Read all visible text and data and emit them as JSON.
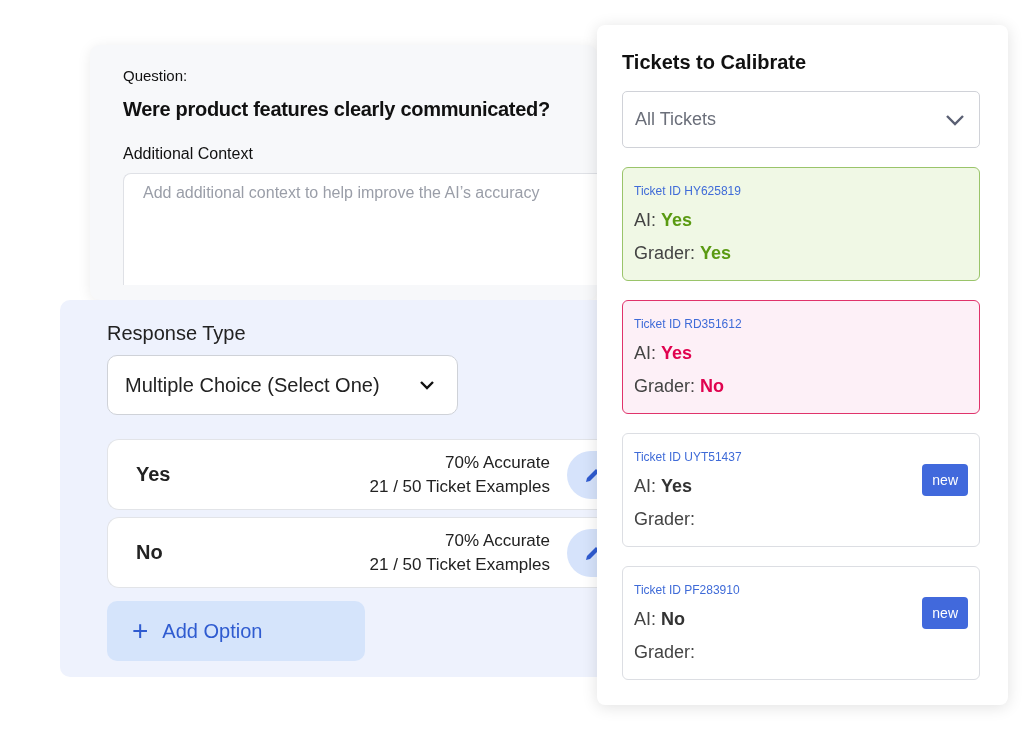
{
  "question_card": {
    "label": "Question:",
    "question": "Were product features clearly communicated?",
    "context_label": "Additional Context",
    "context_field": {
      "placeholder": "Add additional context to help improve the AI’s accuracy"
    }
  },
  "response_panel": {
    "label": "Response Type",
    "dropdown": "Multiple Choice (Select One)",
    "options": [
      {
        "name": "Yes",
        "accuracy": "70% Accurate",
        "examples": "21 / 50 Ticket Examples"
      },
      {
        "name": "No",
        "accuracy": "70% Accurate",
        "examples": "21 / 50 Ticket Examples"
      }
    ],
    "add_button": {
      "icon": "+",
      "label": "Add Option"
    }
  },
  "tickets_panel": {
    "title": "Tickets to Calibrate",
    "filter": "All Tickets",
    "tickets": [
      {
        "kind": "match",
        "id": "Ticket ID HY625819",
        "ai_label": "AI:",
        "ai_value": "Yes",
        "grader_label": "Grader:",
        "grader_value": "Yes"
      },
      {
        "kind": "mismatch",
        "id": "Ticket ID RD351612",
        "ai_label": "AI:",
        "ai_value": "Yes",
        "grader_label": "Grader:",
        "grader_value": "No"
      },
      {
        "kind": "new",
        "id": "Ticket ID UYT51437",
        "ai_label": "AI:",
        "ai_value": "Yes",
        "grader_label": "Grader:",
        "badge": "new"
      },
      {
        "kind": "new",
        "id": "Ticket ID PF283910",
        "ai_label": "AI:",
        "ai_value": "No",
        "grader_label": "Grader:",
        "badge": "new"
      }
    ]
  }
}
